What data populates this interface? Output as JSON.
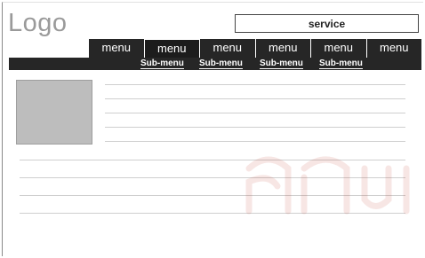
{
  "header": {
    "logo_text": "Logo",
    "service_label": "service"
  },
  "menu": {
    "items": [
      "menu",
      "menu",
      "menu",
      "menu",
      "menu",
      "menu"
    ],
    "active_index": 1
  },
  "submenu": {
    "items": [
      "Sub-menu",
      "Sub-menu",
      "Sub-menu",
      "Sub-menu"
    ]
  },
  "content": {
    "image_placeholder": "gray-image-placeholder",
    "text_line_count": 9
  },
  "colors": {
    "menu_bar": "#262626",
    "logo_text": "#9a9a9a",
    "placeholder": "#bdbdbd",
    "line": "#cfcfcf",
    "watermark": "#c0392b"
  }
}
